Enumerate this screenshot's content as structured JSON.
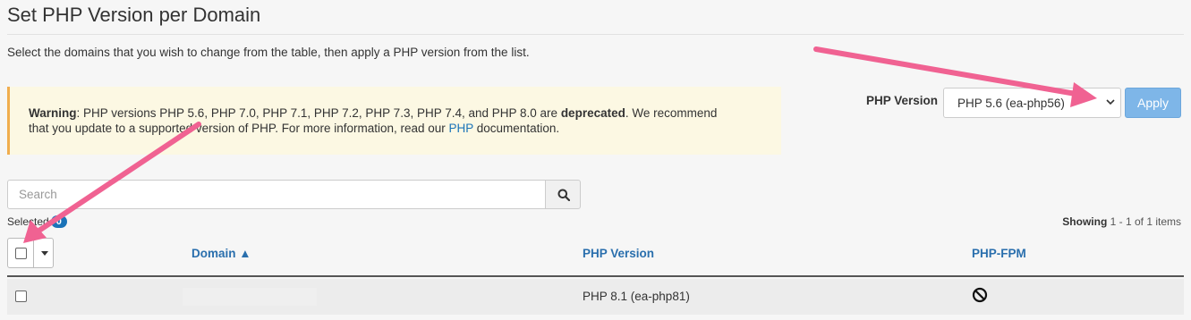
{
  "page": {
    "title": "Set PHP Version per Domain",
    "description": "Select the domains that you wish to change from the table, then apply a PHP version from the list."
  },
  "warning": {
    "label": "Warning",
    "text_before": ": PHP versions PHP 5.6, PHP 7.0, PHP 7.1, PHP 7.2, PHP 7.3, PHP 7.4, and PHP 8.0 are ",
    "emphasis": "deprecated",
    "text_after": ". We recommend",
    "line2_before": "that you update to a supported version of PHP. For more information, read our ",
    "link": "PHP",
    "line2_after": " documentation."
  },
  "php_selector": {
    "label": "PHP Version",
    "selected": "PHP 5.6 (ea-php56)",
    "apply_label": "Apply"
  },
  "search": {
    "placeholder": "Search"
  },
  "selection": {
    "label": "Selected",
    "count": "0"
  },
  "pagination": {
    "prefix": "Showing",
    "range": "1 - 1 of 1 items"
  },
  "table": {
    "columns": {
      "domain": "Domain ▲",
      "php_version": "PHP Version",
      "php_fpm": "PHP-FPM"
    },
    "rows": [
      {
        "php_version": "PHP 8.1 (ea-php81)",
        "php_fpm_icon": "disabled-icon"
      }
    ]
  },
  "annotation_color": "#f06292"
}
